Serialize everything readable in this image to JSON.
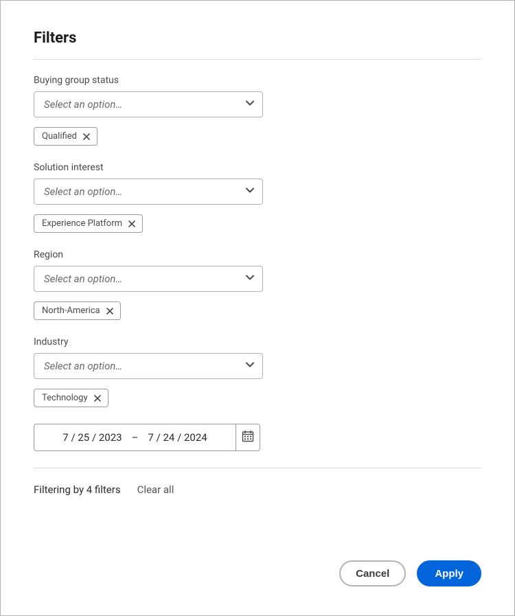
{
  "title": "Filters",
  "placeholder": "Select an option…",
  "filters": {
    "buying_group_status": {
      "label": "Buying group status",
      "tag": "Qualified"
    },
    "solution_interest": {
      "label": "Solution interest",
      "tag": "Experience Platform"
    },
    "region": {
      "label": "Region",
      "tag": "North-America"
    },
    "industry": {
      "label": "Industry",
      "tag": "Technology"
    }
  },
  "date_range": {
    "start": "7 / 25 / 2023",
    "separator": "–",
    "end": "7 / 24 / 2024"
  },
  "summary": {
    "text": "Filtering by 4 filters",
    "clear": "Clear all"
  },
  "footer": {
    "cancel": "Cancel",
    "apply": "Apply"
  }
}
